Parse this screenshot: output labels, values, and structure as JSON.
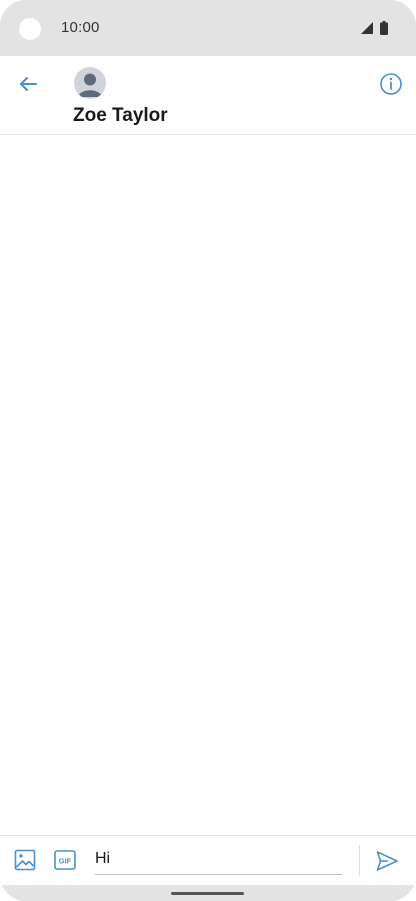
{
  "status_bar": {
    "time": "10:00",
    "icons": [
      "camera-cutout",
      "signal-icon",
      "battery-icon"
    ]
  },
  "header": {
    "contact_name": "Zoe Taylor",
    "icons": [
      "back-arrow-icon",
      "avatar-placeholder-icon",
      "info-icon"
    ]
  },
  "compose": {
    "message_value": "Hi",
    "placeholder": "",
    "icons": [
      "image-icon",
      "gif-icon",
      "send-icon"
    ]
  },
  "colors": {
    "accent": "#4a90c8",
    "chrome": "#e3e3e3",
    "text": "#1a1a1a",
    "avatar_bg": "#d0d4da",
    "avatar_fg": "#5f6b7a"
  }
}
